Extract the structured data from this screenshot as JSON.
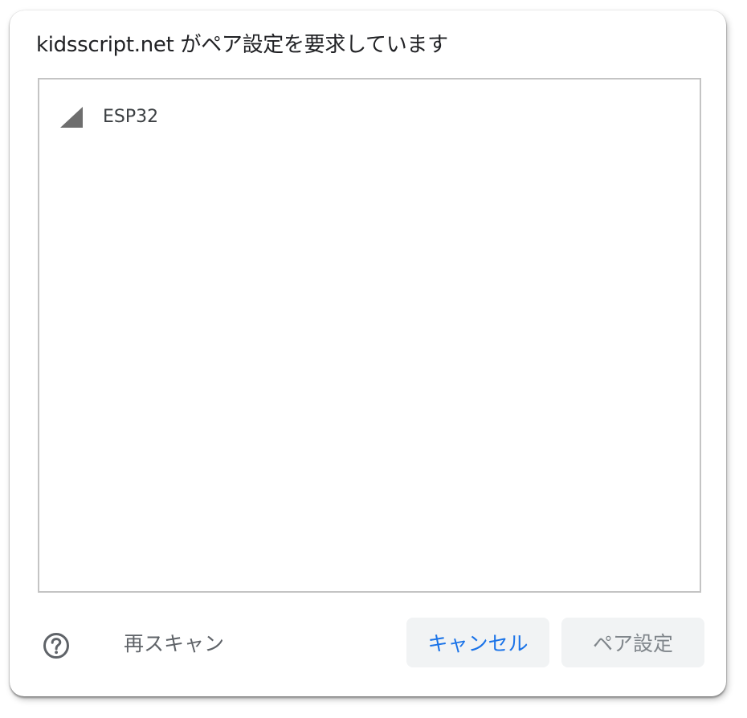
{
  "dialog": {
    "title": "kidsscript.net がペア設定を要求しています"
  },
  "device_list": {
    "items": [
      {
        "name": "ESP32",
        "icon": "signal-strength-icon"
      }
    ]
  },
  "footer": {
    "help_icon": "help-circle-icon",
    "rescan_label": "再スキャン",
    "cancel_label": "キャンセル",
    "pair_label": "ペア設定"
  },
  "colors": {
    "accent": "#1a73e8",
    "button_bg": "#f1f3f4",
    "disabled_text": "#80868b",
    "list_border": "#c4c4c4",
    "signal_icon": "#6e6e6e"
  }
}
